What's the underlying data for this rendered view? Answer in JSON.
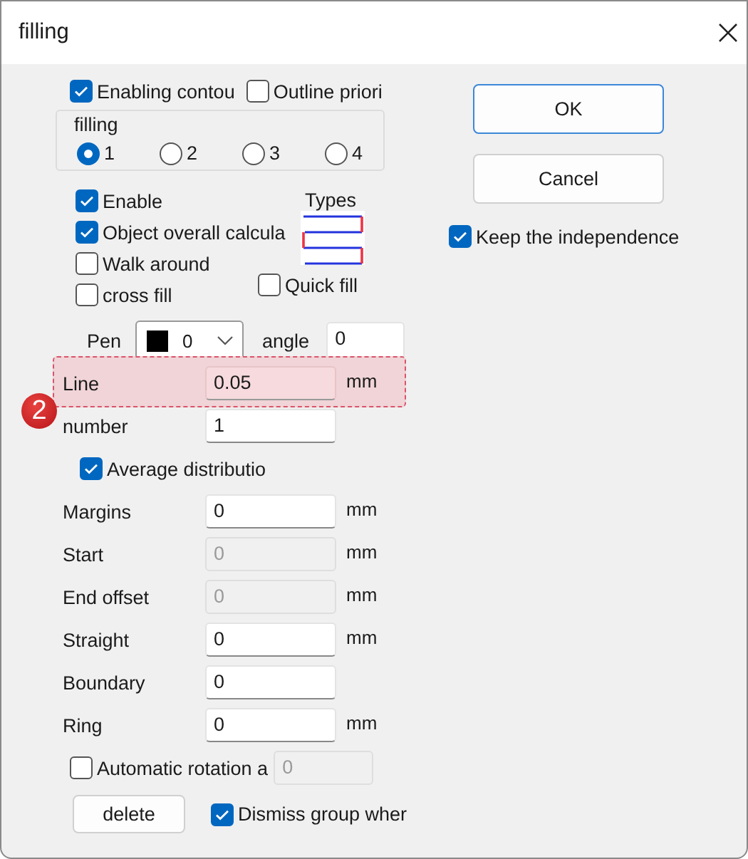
{
  "window": {
    "title": "filling"
  },
  "top_options": [
    {
      "label": "Enabling contou",
      "checked": true
    },
    {
      "label": "Outline priori",
      "checked": false
    }
  ],
  "filling_group": {
    "label": "filling",
    "options": [
      {
        "label": "1",
        "selected": true
      },
      {
        "label": "2",
        "selected": false
      },
      {
        "label": "3",
        "selected": false
      },
      {
        "label": "4",
        "selected": false
      }
    ]
  },
  "fill_options": [
    {
      "label": "Enable",
      "checked": true
    },
    {
      "label": "Object overall calcula",
      "checked": true
    },
    {
      "label": "Walk around",
      "checked": false
    },
    {
      "label": "cross fill",
      "checked": false
    }
  ],
  "quick_fill": {
    "label": "Quick fill",
    "checked": false
  },
  "types": {
    "label": "Types"
  },
  "pen": {
    "label": "Pen",
    "value": "0",
    "color": "#000000"
  },
  "angle": {
    "label": "angle",
    "value": "0"
  },
  "rows": [
    {
      "kind": "field",
      "label": "Line",
      "value": "0.05",
      "unit": "mm",
      "disabled": false,
      "highlighted": true
    },
    {
      "kind": "field",
      "label": "number",
      "value": "1",
      "disabled": false,
      "highlighted": false
    },
    {
      "kind": "checkbox",
      "label": "Average distributio",
      "checked": true
    },
    {
      "kind": "field",
      "label": "Margins",
      "value": "0",
      "unit": "mm",
      "disabled": false,
      "highlighted": false
    },
    {
      "kind": "field",
      "label": "Start",
      "value": "0",
      "unit": "mm",
      "disabled": true,
      "highlighted": false
    },
    {
      "kind": "field",
      "label": "End offset",
      "value": "0",
      "unit": "mm",
      "disabled": true,
      "highlighted": false
    },
    {
      "kind": "field",
      "label": "Straight",
      "value": "0",
      "unit": "mm",
      "disabled": false,
      "highlighted": false
    },
    {
      "kind": "field",
      "label": "Boundary",
      "value": "0",
      "disabled": false,
      "highlighted": false
    },
    {
      "kind": "field",
      "label": "Ring",
      "value": "0",
      "unit": "mm",
      "disabled": false,
      "highlighted": false
    }
  ],
  "annotation_badge": "2",
  "auto_rotation": {
    "label": "Automatic rotation a",
    "checked": false,
    "value": "0",
    "disabled": true
  },
  "delete_button": "delete",
  "dismiss_group": {
    "label": "Dismiss group wher",
    "checked": true
  },
  "buttons": [
    {
      "label": "OK",
      "default": true
    },
    {
      "label": "Cancel",
      "default": false
    }
  ],
  "keep_independence": {
    "label": "Keep the independence",
    "checked": true
  }
}
